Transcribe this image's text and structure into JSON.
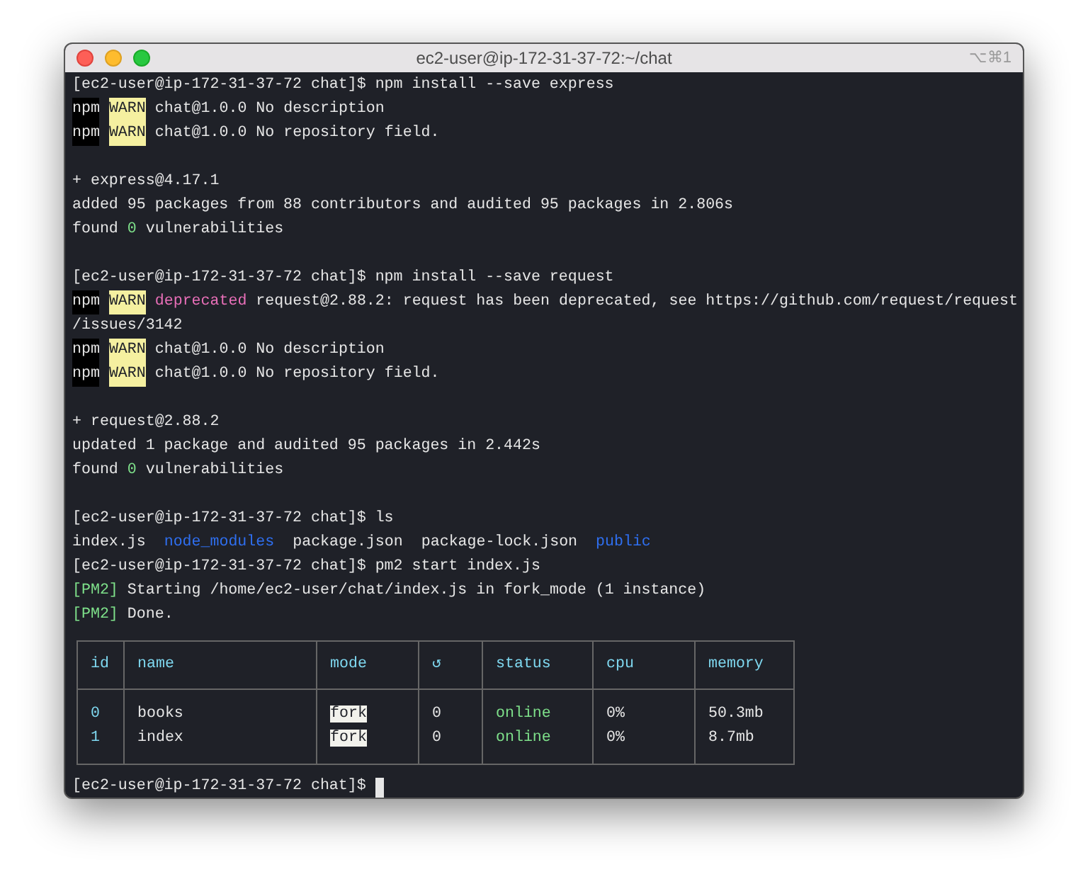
{
  "window": {
    "title": "ec2-user@ip-172-31-37-72:~/chat",
    "shortcut": "⌥⌘1"
  },
  "lines": [
    {
      "kind": "text",
      "segments": [
        {
          "kind": "plain",
          "text": "[ec2-user@ip-172-31-37-72 chat]$ npm install --save express"
        }
      ]
    },
    {
      "kind": "text",
      "segments": [
        {
          "kind": "npm",
          "text": "npm"
        },
        {
          "kind": "warn",
          "text": "WARN"
        },
        {
          "kind": "plain",
          "text": "chat@1.0.0 No description"
        }
      ]
    },
    {
      "kind": "text",
      "segments": [
        {
          "kind": "npm",
          "text": "npm"
        },
        {
          "kind": "warn",
          "text": "WARN"
        },
        {
          "kind": "plain",
          "text": "chat@1.0.0 No repository field."
        }
      ]
    },
    {
      "kind": "blank"
    },
    {
      "kind": "text",
      "segments": [
        {
          "kind": "plain",
          "text": "+ express@4.17.1"
        }
      ]
    },
    {
      "kind": "text",
      "segments": [
        {
          "kind": "plain",
          "text": "added 95 packages from 88 contributors and audited 95 packages in 2.806s"
        }
      ]
    },
    {
      "kind": "text",
      "segments": [
        {
          "kind": "plain",
          "text": "found"
        },
        {
          "kind": "green",
          "text": "0"
        },
        {
          "kind": "plain",
          "text": "vulnerabilities"
        }
      ]
    },
    {
      "kind": "blank"
    },
    {
      "kind": "text",
      "segments": [
        {
          "kind": "plain",
          "text": "[ec2-user@ip-172-31-37-72 chat]$ npm install --save request"
        }
      ]
    },
    {
      "kind": "text",
      "segments": [
        {
          "kind": "npm",
          "text": "npm"
        },
        {
          "kind": "warn",
          "text": "WARN"
        },
        {
          "kind": "magenta",
          "text": "deprecated"
        },
        {
          "kind": "plain",
          "text": "request@2.88.2: request has been deprecated, see https://github.com/request/request"
        }
      ]
    },
    {
      "kind": "text",
      "segments": [
        {
          "kind": "plain",
          "text": "/issues/3142"
        }
      ]
    },
    {
      "kind": "text",
      "segments": [
        {
          "kind": "npm",
          "text": "npm"
        },
        {
          "kind": "warn",
          "text": "WARN"
        },
        {
          "kind": "plain",
          "text": "chat@1.0.0 No description"
        }
      ]
    },
    {
      "kind": "text",
      "segments": [
        {
          "kind": "npm",
          "text": "npm"
        },
        {
          "kind": "warn",
          "text": "WARN"
        },
        {
          "kind": "plain",
          "text": "chat@1.0.0 No repository field."
        }
      ]
    },
    {
      "kind": "blank"
    },
    {
      "kind": "text",
      "segments": [
        {
          "kind": "plain",
          "text": "+ request@2.88.2"
        }
      ]
    },
    {
      "kind": "text",
      "segments": [
        {
          "kind": "plain",
          "text": "updated 1 package and audited 95 packages in 2.442s"
        }
      ]
    },
    {
      "kind": "text",
      "segments": [
        {
          "kind": "plain",
          "text": "found"
        },
        {
          "kind": "green",
          "text": "0"
        },
        {
          "kind": "plain",
          "text": "vulnerabilities"
        }
      ]
    },
    {
      "kind": "blank"
    },
    {
      "kind": "text",
      "segments": [
        {
          "kind": "plain",
          "text": "[ec2-user@ip-172-31-37-72 chat]$ ls"
        }
      ]
    },
    {
      "kind": "files",
      "segments": [
        {
          "kind": "plain",
          "text": "index.js"
        },
        {
          "kind": "blue",
          "text": "node_modules"
        },
        {
          "kind": "plain",
          "text": "package.json"
        },
        {
          "kind": "plain",
          "text": "package-lock.json"
        },
        {
          "kind": "blue",
          "text": "public"
        }
      ]
    },
    {
      "kind": "text",
      "segments": [
        {
          "kind": "plain",
          "text": "[ec2-user@ip-172-31-37-72 chat]$ pm2 start index.js"
        }
      ]
    },
    {
      "kind": "text",
      "segments": [
        {
          "kind": "green",
          "text": "[PM2]"
        },
        {
          "kind": "plain",
          "text": "Starting /home/ec2-user/chat/index.js in fork_mode (1 instance)"
        }
      ]
    },
    {
      "kind": "text",
      "segments": [
        {
          "kind": "green",
          "text": "[PM2]"
        },
        {
          "kind": "plain",
          "text": "Done."
        }
      ]
    }
  ],
  "table": {
    "columns": [
      "id",
      "name",
      "mode",
      "↺",
      "status",
      "cpu",
      "memory"
    ],
    "rows": [
      [
        "0",
        "books",
        "fork",
        "0",
        "online",
        "0%",
        "50.3mb"
      ],
      [
        "1",
        "index",
        "fork",
        "0",
        "online",
        "0%",
        "8.7mb"
      ]
    ]
  },
  "prompt": "[ec2-user@ip-172-31-37-72 chat]$"
}
